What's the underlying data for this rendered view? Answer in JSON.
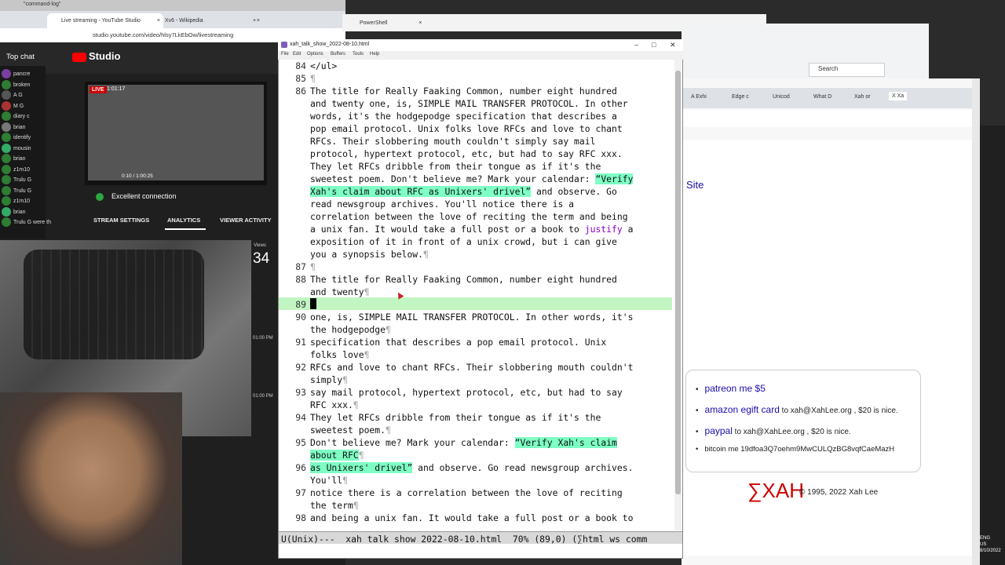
{
  "top_strip": {
    "tab1": "\"command-log\""
  },
  "studio_browser": {
    "tabs": [
      {
        "label": "Live streaming - YouTube Studio",
        "close": "×"
      },
      {
        "label": "Xv6 - Wikipedia",
        "close": "×"
      },
      {
        "label": "+"
      }
    ],
    "address": "studio.youtube.com/video/hlsy7LkEbOw/livestreaming"
  },
  "studio": {
    "logo": "Studio",
    "top_chat": "Top chat",
    "chat_items": [
      "pancre",
      "broken",
      "A G",
      "M G",
      "diary c",
      "brian",
      "identify",
      "mousin",
      "brian",
      "z1m10",
      "Trulu G",
      "Trulu G",
      "z1m10",
      "brian",
      "Trulu G were th"
    ],
    "live_badge": "LIVE",
    "live_time": "1:01:17",
    "video_time": "0:10 / 1:00:25",
    "connection": "Excellent connection",
    "tabs": [
      "STREAM SETTINGS",
      "ANALYTICS",
      "VIEWER ACTIVITY"
    ],
    "views_label": "Views",
    "views": "34",
    "time_marks": [
      "01:00 PM",
      "01:00 PM"
    ]
  },
  "powershell": {
    "title": "PowerShell",
    "close": "×"
  },
  "right_browser": {
    "search_placeholder": "Search",
    "tabs": [
      "A Exhi",
      "Edge c",
      "Unicod",
      "What D",
      "Xah or",
      "X Xa"
    ],
    "site_link": "Site",
    "donate": [
      {
        "link": "patreon me $5",
        "rest": ""
      },
      {
        "link": "amazon egift card",
        "rest": " to xah@XahLee.org , $20 is nice."
      },
      {
        "link": "paypal",
        "rest": " to xah@XahLee.org , $20 is nice."
      },
      {
        "link": "",
        "rest": "bitcoin me 19dfoa3Q7oehm9MwCULQzBG8vqfCaeMazH"
      }
    ],
    "footer_logo": "∑XAH",
    "footer_copy": "© 1995, 2022 Xah Lee",
    "clock": [
      "ENG",
      "US",
      "8/10/2022"
    ]
  },
  "emacs": {
    "title": "xah_talk_show_2022-08-10.html",
    "menu": [
      "File",
      "Edit",
      "Options",
      "Buffers",
      "Tools",
      "Help"
    ],
    "lines": [
      {
        "n": "84",
        "t": "</ul>"
      },
      {
        "n": "85",
        "t": ""
      },
      {
        "n": "86",
        "t": "The title for Really Faaking Common, number eight hundred"
      },
      {
        "n": "",
        "t": "and twenty one, is, SIMPLE MAIL TRANSFER PROTOCOL. In other"
      },
      {
        "n": "",
        "t": "words, it's the hodgepodge specification that describes a"
      },
      {
        "n": "",
        "t": "pop email protocol. Unix folks love RFCs and love to chant"
      },
      {
        "n": "",
        "t": "RFCs. Their slobbering mouth couldn't simply say mail"
      },
      {
        "n": "",
        "t": "protocol, hypertext protocol, etc, but had to say RFC xxx."
      },
      {
        "n": "",
        "t": "They let RFCs dribble from their tongue as if it's the"
      },
      {
        "n": "",
        "t": "sweetest poem. Don't believe me? Mark your calendar: "
      },
      {
        "n": "",
        "t": ""
      },
      {
        "n": "",
        "t": "read newsgroup archives. You'll notice there is a"
      },
      {
        "n": "",
        "t": "correlation between the love of reciting the term and being"
      },
      {
        "n": "",
        "t": "a unix fan. It would take a full post or a book to "
      },
      {
        "n": "",
        "t": "exposition of it in front of a unix crowd, but i can give"
      },
      {
        "n": "",
        "t": "you a synopsis below."
      },
      {
        "n": "87",
        "t": ""
      },
      {
        "n": "88",
        "t": "The title for Really Faaking Common, number eight hundred"
      },
      {
        "n": "",
        "t": "and twenty"
      },
      {
        "n": "89",
        "t": ""
      },
      {
        "n": "90",
        "t": "one, is, SIMPLE MAIL TRANSFER PROTOCOL. In other words, it's"
      },
      {
        "n": "",
        "t": "the hodgepodge"
      },
      {
        "n": "91",
        "t": "specification that describes a pop email protocol. Unix"
      },
      {
        "n": "",
        "t": "folks love"
      },
      {
        "n": "92",
        "t": "RFCs and love to chant RFCs. Their slobbering mouth couldn't"
      },
      {
        "n": "",
        "t": "simply"
      },
      {
        "n": "93",
        "t": "say mail protocol, hypertext protocol, etc, but had to say"
      },
      {
        "n": "",
        "t": "RFC xxx."
      },
      {
        "n": "94",
        "t": "They let RFCs dribble from their tongue as if it's the"
      },
      {
        "n": "",
        "t": "sweetest poem."
      },
      {
        "n": "95",
        "t": "Don't believe me? Mark your calendar: "
      },
      {
        "n": "",
        "t": ""
      },
      {
        "n": "96",
        "t": ""
      },
      {
        "n": "",
        "t": "You'll"
      },
      {
        "n": "97",
        "t": "notice there is a correlation between the love of reciting"
      },
      {
        "n": "",
        "t": "the term"
      },
      {
        "n": "98",
        "t": "and being a unix fan. It would take a full post or a book to"
      }
    ],
    "spans": {
      "verify1": "“Verify",
      "verify1b": "Xah's claim about RFC as Unixers' drivel”",
      "verify1c": " and observe. Go",
      "justify": "justify",
      "a_tail": " a",
      "verify2": "“Verify Xah's claim",
      "about_rfc": "about RFC",
      "as_unixers": "as Unixers' drivel”",
      "observe2": " and observe. Go read newsgroup archives."
    },
    "pilcrow": "¶",
    "modeline": "U(Unix)---  xah_talk_show_2022-08-10.html  70% (89,0) (∑html ws comm"
  }
}
